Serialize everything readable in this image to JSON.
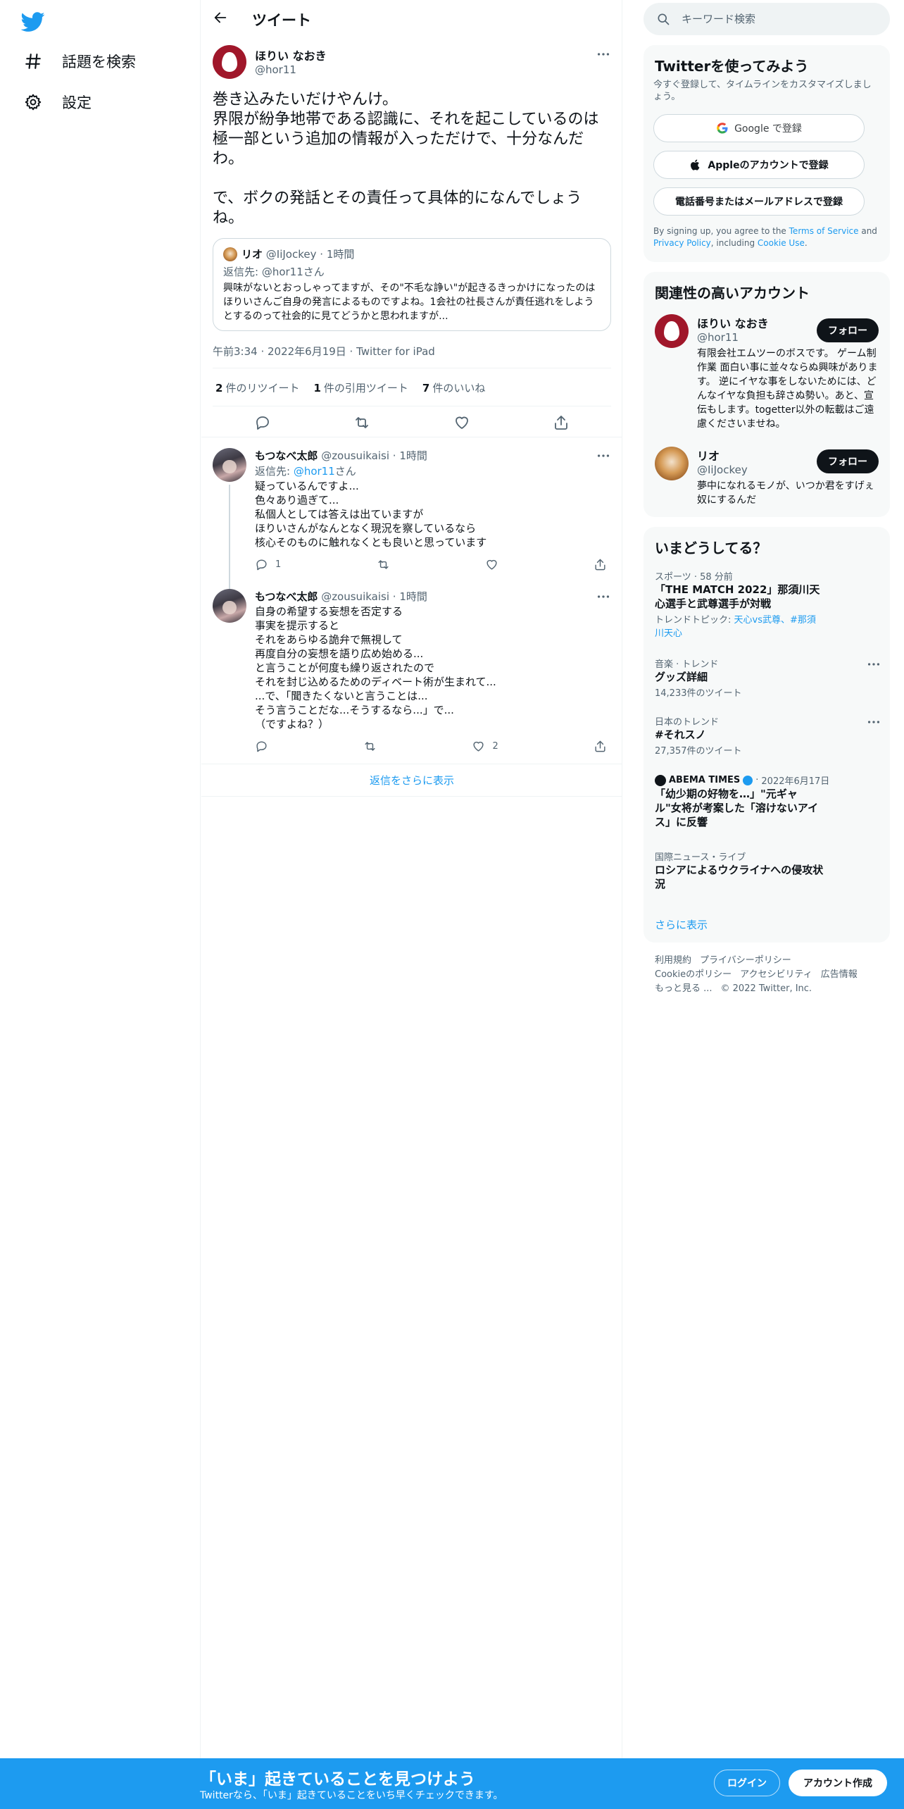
{
  "nav": {
    "logo": "twitter-bird-icon",
    "items": [
      {
        "label": "話題を検索",
        "icon": "hashtag-icon"
      },
      {
        "label": "設定",
        "icon": "gear-icon"
      }
    ]
  },
  "header": {
    "title": "ツイート"
  },
  "tweet": {
    "name": "ほりい なおき",
    "handle": "@hor11",
    "text": "巻き込みたいだけやんけ。\n界限が紛争地帯である認識に、それを起こしているのは極一部という追加の情報が入っただけで、十分なんだわ。\n\nで、ボクの発話とその責任って具体的になんでしょうね。",
    "quote": {
      "name": "リオ",
      "handle": "@IiJockey",
      "time": "1時間",
      "reply_to": "返信先: @hor11さん",
      "body": "興味がないとおっしゃってますが、その\"不毛な諍い\"が起きるきっかけになったのはほりいさんご自身の発言によるものですよね。1会社の社長さんが責任逃れをしようとするのって社会的に見てどうかと思われますが..."
    },
    "meta": "午前3:34 · 2022年6月19日 · Twitter for iPad",
    "stats": {
      "retweets_count": "2",
      "retweets_label": "件のリツイート",
      "quotes_count": "1",
      "quotes_label": "件の引用ツイート",
      "likes_count": "7",
      "likes_label": "件のいいね"
    }
  },
  "replies": [
    {
      "name": "もつなべ太郎",
      "handle": "@zousuikaisi",
      "time": "1時間",
      "reply_prefix": "返信先: ",
      "reply_link": "@hor11",
      "reply_suffix": "さん",
      "text": "疑っているんですよ...\n色々あり過ぎて...\n私個人としては答えは出ていますが\nほりいさんがなんとなく現況を察しているなら\n核心そのものに触れなくとも良いと思っています",
      "reply_count": "1",
      "like_count": ""
    },
    {
      "name": "もつなべ太郎",
      "handle": "@zousuikaisi",
      "time": "1時間",
      "text": "自身の希望する妄想を否定する\n事実を提示すると\nそれをあらゆる詭弁で無視して\n再度自分の妄想を語り広め始める...\nと言うことが何度も繰り返されたので\nそれを封じ込めるためのディベート術が生まれて...\n...で、「聞きたくないと言うことは...\nそう言うことだな...そうするなら...」で...\n（ですよね？）",
      "reply_count": "",
      "like_count": "2"
    }
  ],
  "show_more_replies": "返信をさらに表示",
  "search": {
    "placeholder": "キーワード検索"
  },
  "signup_panel": {
    "title": "Twitterを使ってみよう",
    "subtitle": "今すぐ登録して、タイムラインをカスタマイズしましょう。",
    "google": "Google で登録",
    "apple": "Appleのアカウントで登録",
    "phone": "電話番号またはメールアドレスで登録",
    "legal_1": "By signing up, you agree to the ",
    "legal_tos": "Terms of Service",
    "legal_2": " and ",
    "legal_privacy": "Privacy Policy",
    "legal_3": ", including ",
    "legal_cookie": "Cookie Use",
    "legal_4": "."
  },
  "related_panel": {
    "title": "関連性の高いアカウント",
    "accounts": [
      {
        "name": "ほりい なおき",
        "handle": "@hor11",
        "follow": "フォロー",
        "bio": "有限会社エムツーのボスです。 ゲーム制作業 面白い事に並々ならぬ興味があります。 逆にイヤな事をしないためには、どんなイヤな負担も辞さぬ勢い。あと、宣伝もします。togetter以外の転載はご遠慮くださいませね。"
      },
      {
        "name": "リオ",
        "handle": "@IiJockey",
        "follow": "フォロー",
        "bio": "夢中になれるモノが、いつか君をすげぇ奴にするんだ"
      }
    ]
  },
  "trends_panel": {
    "title": "いまどうしてる？",
    "trends": [
      {
        "context": "スポーツ · 58 分前",
        "title": "「THE MATCH 2022」那須川天心選手と武尊選手が対戦",
        "topic_prefix": "トレンドトピック: ",
        "topic_links": "天心vs武尊、#那須川天心"
      },
      {
        "context": "音楽 · トレンド",
        "title": "グッズ詳細",
        "count": "14,233件のツイート"
      },
      {
        "context": "日本のトレンド",
        "title": "#それスノ",
        "count": "27,357件のツイート"
      },
      {
        "source": "ABEMA TIMES",
        "date": "2022年6月17日",
        "title": "「幼少期の好物を…」\"元ギャル\"女将が考案した「溶けないアイス」に反響"
      },
      {
        "context": "国際ニュース・ライブ",
        "title": "ロシアによるウクライナへの侵攻状況"
      }
    ],
    "show_more": "さらに表示"
  },
  "footer": {
    "links": [
      "利用規約",
      "プライバシーポリシー",
      "Cookieのポリシー",
      "アクセシビリティ",
      "広告情報",
      "もっと見る ..."
    ],
    "copyright": "© 2022 Twitter, Inc."
  },
  "bottom_bar": {
    "title": "「いま」起きていることを見つけよう",
    "subtitle": "Twitterなら、「いま」起きていることをいち早くチェックできます。",
    "login": "ログイン",
    "signup": "アカウント作成"
  },
  "colors": {
    "accent": "#1d9bf0",
    "text": "#0f1419",
    "muted": "#536471",
    "bottom_bar": "#1d9bf0"
  }
}
